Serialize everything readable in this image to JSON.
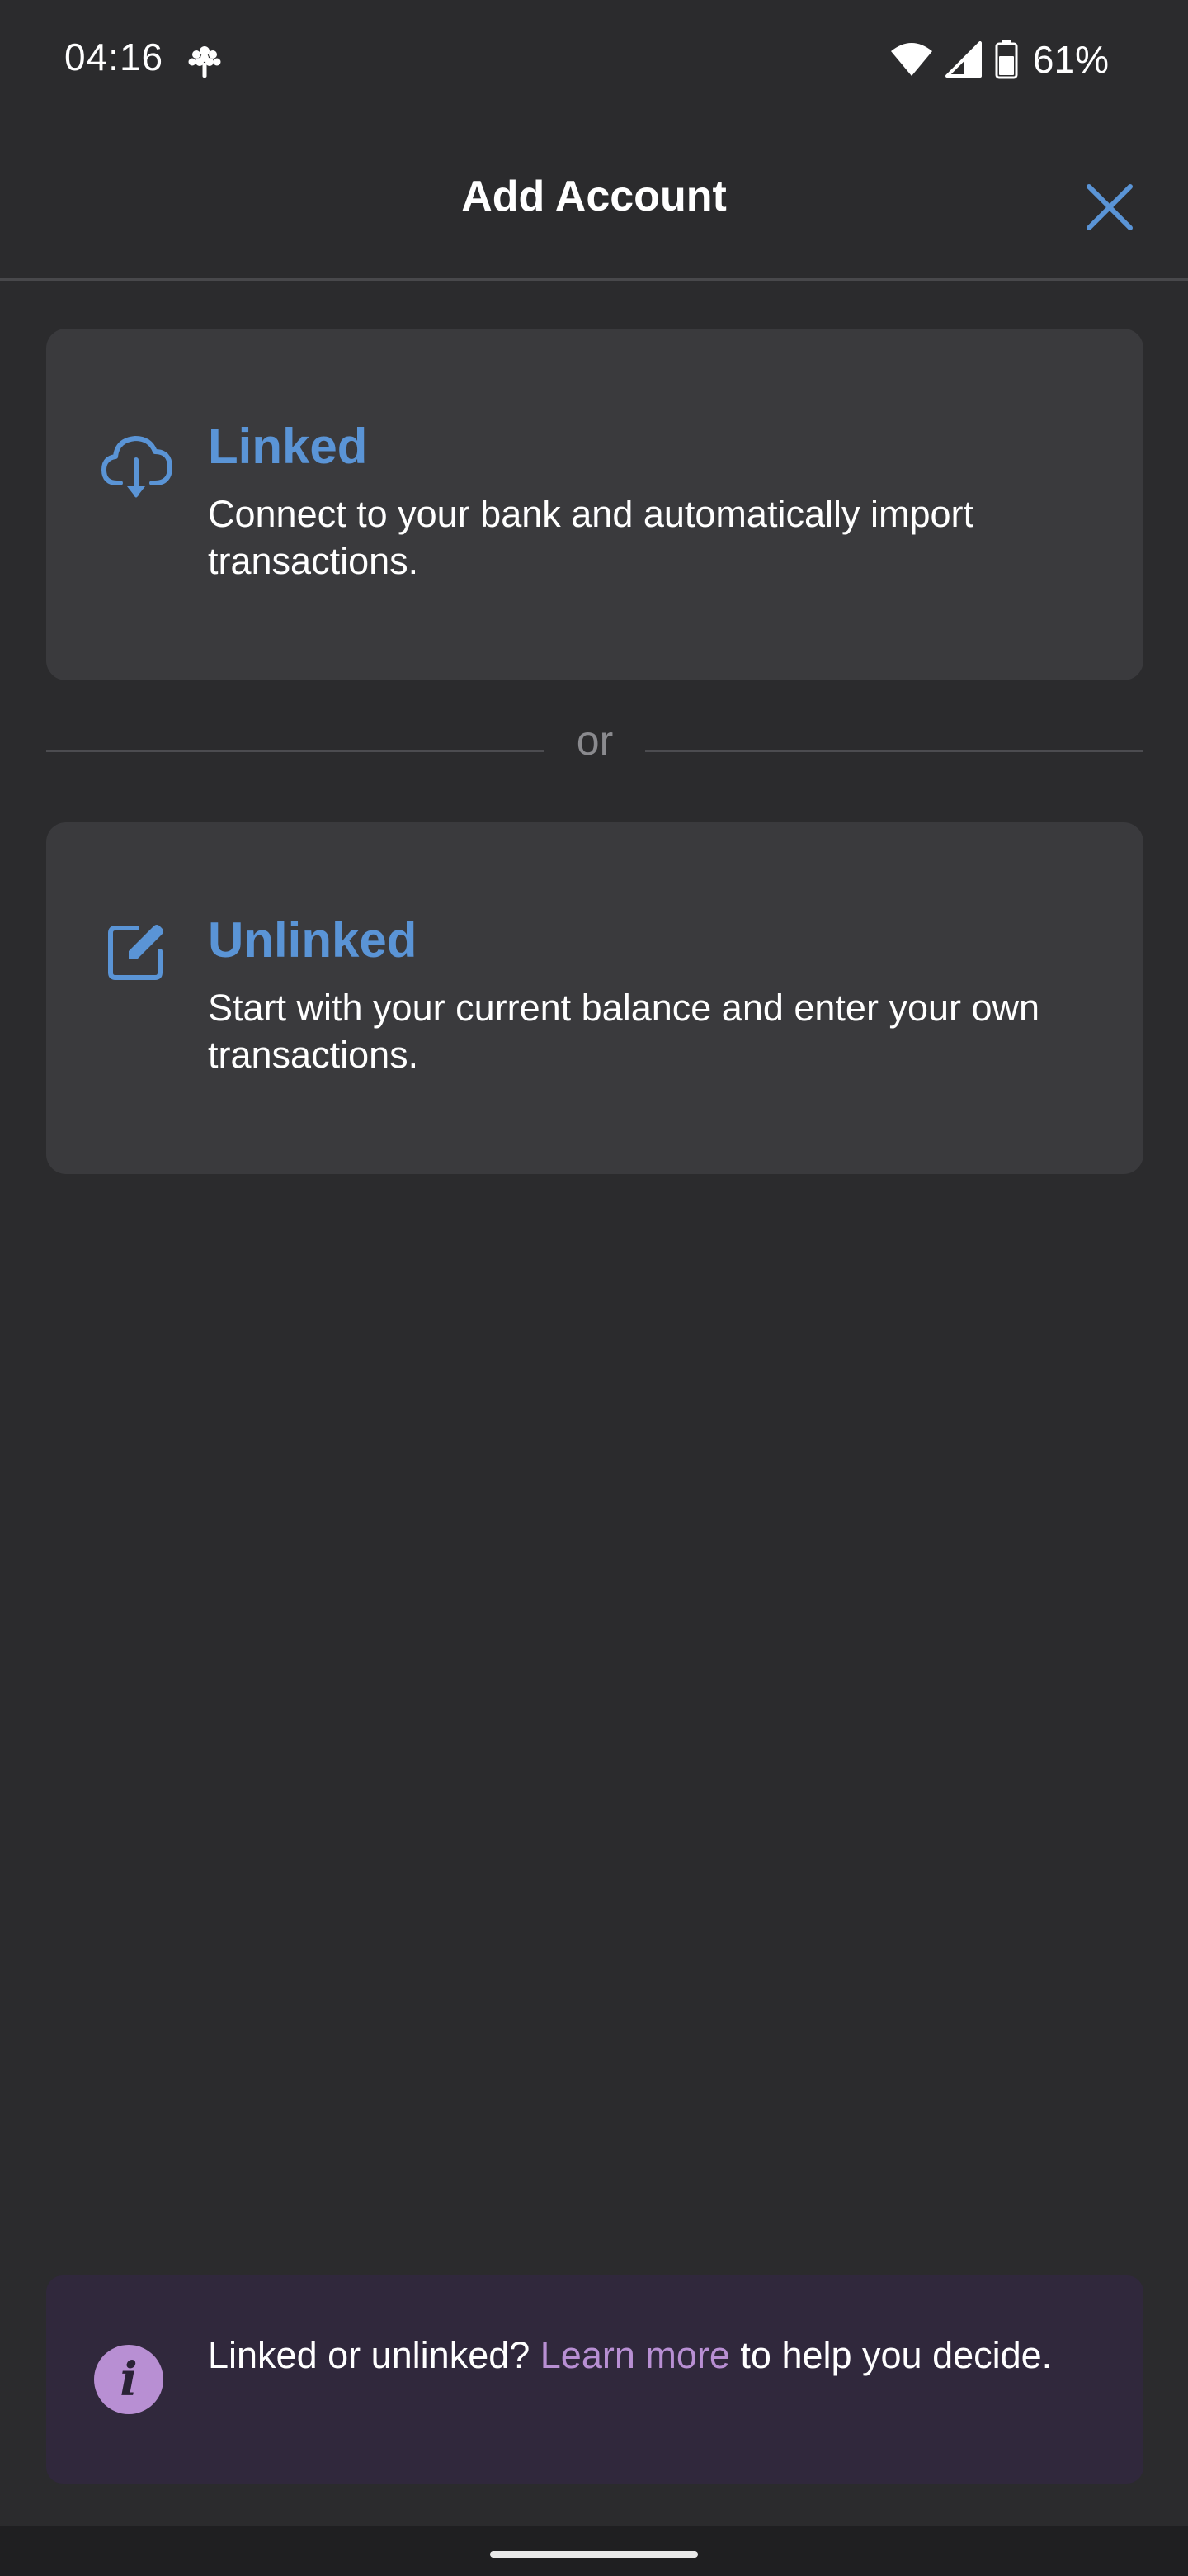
{
  "status_bar": {
    "time": "04:16",
    "app_icon": "tree-icon",
    "wifi_icon": "wifi-icon",
    "signal_icon": "cell-signal-icon",
    "battery_icon": "battery-icon",
    "battery_percent": "61%"
  },
  "header": {
    "title": "Add Account",
    "close_icon": "close-icon"
  },
  "options": {
    "linked": {
      "icon": "cloud-download-icon",
      "title": "Linked",
      "description": "Connect to your bank and automatically import transactions."
    },
    "divider_text": "or",
    "unlinked": {
      "icon": "edit-icon",
      "title": "Unlinked",
      "description": "Start with your current balance and enter your own transactions."
    }
  },
  "info_banner": {
    "icon": "info-icon",
    "icon_glyph": "i",
    "text_before": "Linked or unlinked? ",
    "link_text": "Learn more",
    "text_after": " to help you decide."
  },
  "colors": {
    "background": "#2b2b2d",
    "card": "#3a3a3d",
    "accent_blue": "#5a94d6",
    "accent_purple": "#b88fd3",
    "banner_bg": "#30283c"
  }
}
